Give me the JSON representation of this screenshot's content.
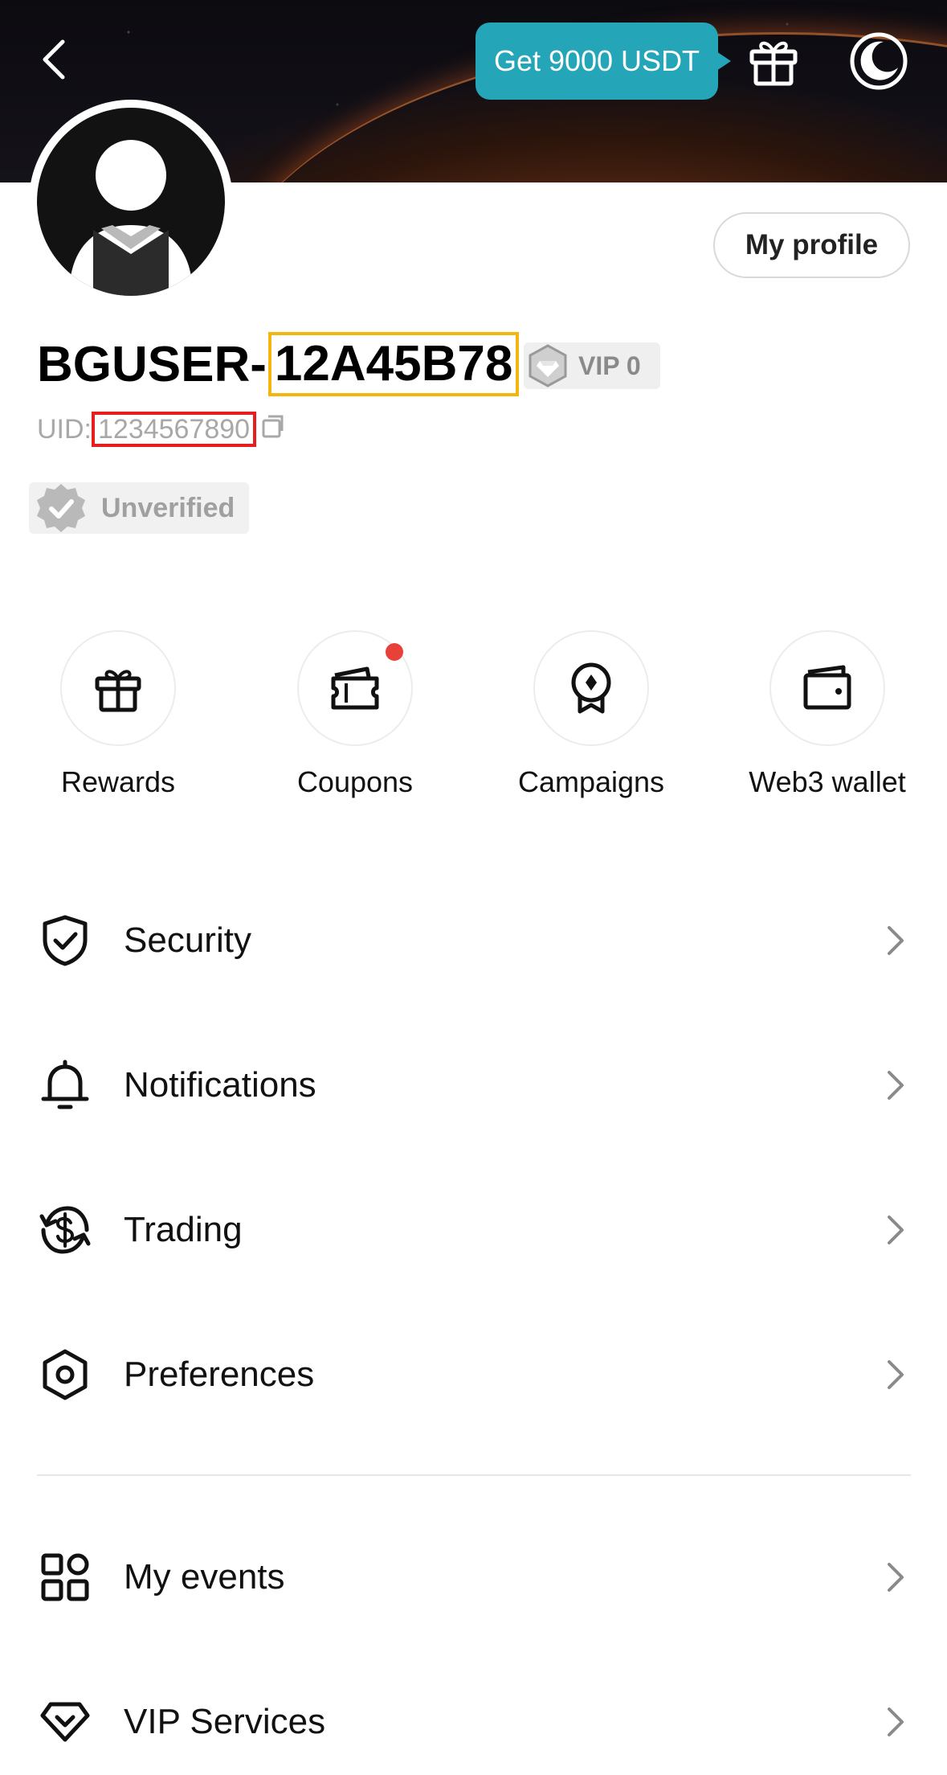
{
  "header": {
    "promo_label": "Get 9000 USDT"
  },
  "profile": {
    "my_profile_label": "My profile",
    "username_prefix": "BGUSER-",
    "username_id": "12A45B78",
    "vip_label": "VIP 0",
    "uid_label": "UID:",
    "uid_value": "1234567890",
    "verification_status": "Unverified"
  },
  "quick_actions": [
    {
      "label": "Rewards",
      "icon": "gift-icon",
      "badge": false
    },
    {
      "label": "Coupons",
      "icon": "ticket-icon",
      "badge": true
    },
    {
      "label": "Campaigns",
      "icon": "medal-icon",
      "badge": false
    },
    {
      "label": "Web3 wallet",
      "icon": "wallet-icon",
      "badge": false
    }
  ],
  "menu": [
    {
      "label": "Security",
      "icon": "shield-check-icon"
    },
    {
      "label": "Notifications",
      "icon": "bell-icon"
    },
    {
      "label": "Trading",
      "icon": "dollar-cycle-icon"
    },
    {
      "label": "Preferences",
      "icon": "hexagon-settings-icon"
    },
    {
      "label": "My events",
      "icon": "grid-icon"
    },
    {
      "label": "VIP Services",
      "icon": "diamond-icon"
    }
  ],
  "colors": {
    "promo_bg": "#24a6b8",
    "username_highlight": "#f5b50f",
    "uid_highlight": "#e61e1e",
    "badge_dot": "#e8413a"
  }
}
